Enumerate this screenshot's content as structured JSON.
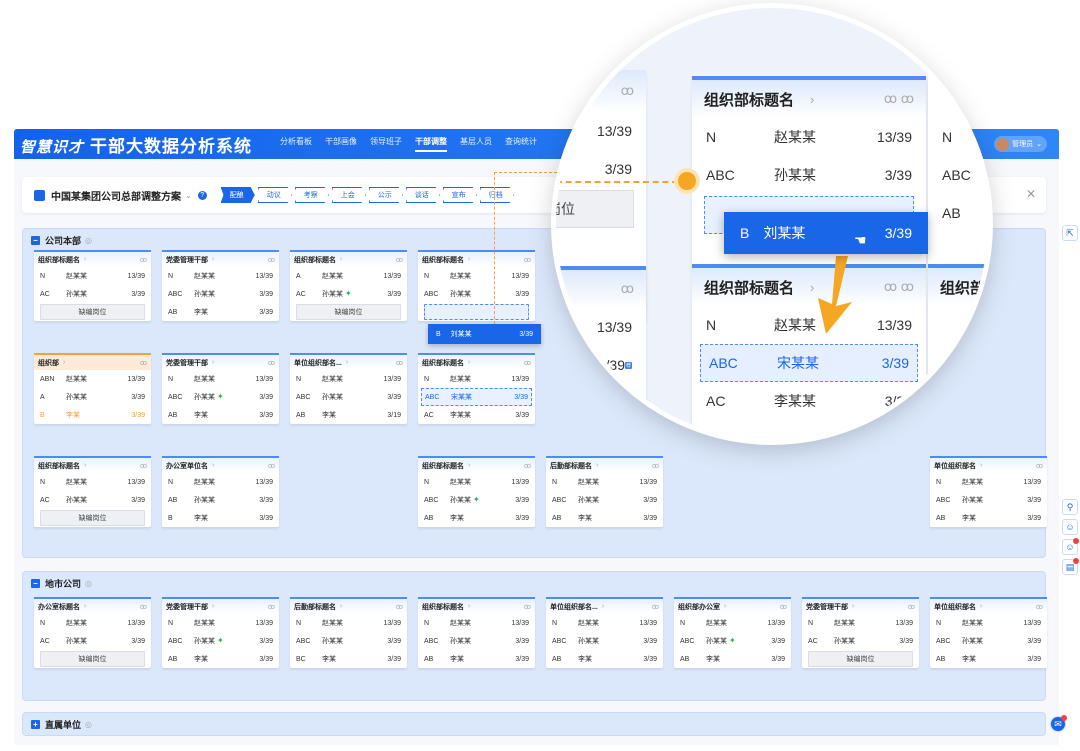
{
  "app": {
    "logo": "智慧识才",
    "title": "干部大数据分析系统"
  },
  "nav": [
    "分析看板",
    "干部画像",
    "领导班子",
    "干部调整",
    "基层人员",
    "查询统计"
  ],
  "nav_active": 3,
  "user": {
    "name": "管理员"
  },
  "plan": {
    "title": "中国某集团公司总部调整方案",
    "steps": [
      "配酿",
      "动议",
      "考察",
      "上会",
      "公示",
      "谈话",
      "宣布",
      "归档"
    ],
    "active_step": 0
  },
  "sections": [
    {
      "title": "公司本部"
    },
    {
      "title": "地市公司"
    },
    {
      "title": "直属单位"
    }
  ],
  "drag": {
    "code": "B",
    "name": "刘某某",
    "value": "3/39"
  },
  "vacancy": "缺编岗位",
  "cards_head": [
    {
      "title": "组织部标题名",
      "rows": [
        [
          "N",
          "赵某某",
          "13/39"
        ],
        [
          "AC",
          "孙某某",
          "3/39"
        ]
      ],
      "vac": true
    },
    {
      "title": "党委管理干部",
      "rows": [
        [
          "N",
          "赵某某",
          "13/39"
        ],
        [
          "ABC",
          "孙某某",
          "3/39"
        ],
        [
          "AB",
          "李某",
          "3/39"
        ]
      ]
    },
    {
      "title": "组织部标题名",
      "rows": [
        [
          "A",
          "赵某某",
          "13/39"
        ],
        [
          "AC",
          "孙某某",
          "3/39"
        ]
      ],
      "vac": true,
      "pin": 1
    },
    {
      "title": "组织部标题名",
      "rows": [
        [
          "N",
          "赵某某",
          "13/39"
        ],
        [
          "ABC",
          "孙某某",
          "3/39"
        ]
      ],
      "drop": true
    },
    {
      "title": "组织部",
      "orange": true,
      "rows": [
        [
          "ABN",
          "赵某某",
          "13/39"
        ],
        [
          "A",
          "孙某某",
          "3/39"
        ],
        [
          "B",
          "李某",
          "3/39"
        ]
      ],
      "warn": 2
    },
    {
      "title": "党委管理干部",
      "rows": [
        [
          "N",
          "赵某某",
          "13/39"
        ],
        [
          "ABC",
          "孙某某",
          "3/39"
        ],
        [
          "AB",
          "李某",
          "3/39"
        ]
      ],
      "pin": 1
    },
    {
      "title": "单位组织部名...",
      "rows": [
        [
          "N",
          "赵某某",
          "13/39"
        ],
        [
          "ABC",
          "孙某某",
          "3/39"
        ],
        [
          "AB",
          "李某",
          "3/19"
        ]
      ]
    },
    {
      "title": "组织部标题名",
      "rows": [
        [
          "N",
          "赵某某",
          "13/39"
        ],
        [
          "ABC",
          "宋某某",
          "3/39"
        ],
        [
          "AC",
          "李某某",
          "3/39"
        ]
      ],
      "hl": 1
    },
    {
      "title": "组织部标题名",
      "rows": [
        [
          "N",
          "赵某某",
          "13/39"
        ],
        [
          "AC",
          "孙某某",
          "3/39"
        ]
      ],
      "vac": true
    },
    {
      "title": "办公室单位名",
      "rows": [
        [
          "N",
          "赵某某",
          "13/39"
        ],
        [
          "AB",
          "孙某某",
          "3/39"
        ],
        [
          "B",
          "李某",
          "3/39"
        ]
      ]
    },
    {
      "title": "组织部标题名",
      "rows": [
        [
          "N",
          "赵某某",
          "13/39"
        ],
        [
          "ABC",
          "孙某某",
          "3/39"
        ],
        [
          "AB",
          "李某",
          "3/39"
        ]
      ],
      "pin": 1
    },
    {
      "title": "后勤部标题名",
      "rows": [
        [
          "N",
          "赵某某",
          "13/39"
        ],
        [
          "ABC",
          "孙某某",
          "3/39"
        ],
        [
          "AB",
          "李某",
          "3/39"
        ]
      ]
    },
    {
      "title": "单位组织部名",
      "rows": [
        [
          "N",
          "赵某某",
          "13/39"
        ],
        [
          "ABC",
          "孙某某",
          "3/39"
        ],
        [
          "AB",
          "李某",
          "3/39"
        ]
      ]
    }
  ],
  "cards_city": [
    {
      "title": "办公室标题名",
      "rows": [
        [
          "N",
          "赵某某",
          "13/39"
        ],
        [
          "AC",
          "孙某某",
          "3/39"
        ]
      ],
      "vac": true
    },
    {
      "title": "党委管理干部",
      "rows": [
        [
          "N",
          "赵某某",
          "13/39"
        ],
        [
          "ABC",
          "孙某某",
          "3/39"
        ],
        [
          "AB",
          "李某",
          "3/39"
        ]
      ],
      "pin": 1
    },
    {
      "title": "后勤部标题名",
      "rows": [
        [
          "N",
          "赵某某",
          "13/39"
        ],
        [
          "ABC",
          "孙某某",
          "3/39"
        ],
        [
          "BC",
          "李某",
          "3/39"
        ]
      ]
    },
    {
      "title": "组织部标题名",
      "rows": [
        [
          "N",
          "赵某某",
          "13/39"
        ],
        [
          "ABC",
          "孙某某",
          "3/39"
        ],
        [
          "AB",
          "李某",
          "3/39"
        ]
      ]
    },
    {
      "title": "单位组织部名...",
      "rows": [
        [
          "N",
          "赵某某",
          "13/39"
        ],
        [
          "ABC",
          "孙某某",
          "3/39"
        ],
        [
          "AB",
          "李某",
          "3/39"
        ]
      ]
    },
    {
      "title": "组织部办公室",
      "rows": [
        [
          "N",
          "赵某某",
          "13/39"
        ],
        [
          "ABC",
          "孙某某",
          "3/39"
        ],
        [
          "AB",
          "李某",
          "3/39"
        ]
      ],
      "pin": 1
    },
    {
      "title": "党委管理干部",
      "rows": [
        [
          "N",
          "赵某某",
          "13/39"
        ],
        [
          "AC",
          "孙某某",
          "3/39"
        ]
      ],
      "vac": true
    },
    {
      "title": "单位组织部名",
      "rows": [
        [
          "N",
          "赵某某",
          "13/39"
        ],
        [
          "ABC",
          "孙某某",
          "3/39"
        ],
        [
          "AB",
          "李某",
          "3/39"
        ]
      ]
    }
  ],
  "zoom": {
    "cards": [
      {
        "title": "组织部标题名",
        "rows": [
          [
            "N",
            "赵某某",
            "13/39"
          ],
          [
            "ABC",
            "孙某某",
            "3/39"
          ]
        ],
        "vac": true
      },
      {
        "title": "组织部标题名",
        "rows": [
          [
            "N",
            "赵某某",
            "13/39"
          ],
          [
            "ABC",
            "宋某某",
            "3/39"
          ],
          [
            "AC",
            "李某某",
            "3/39"
          ]
        ],
        "hl": 1
      }
    ],
    "left_values": [
      "13/39",
      "3/39",
      "3/39",
      "3/19"
    ],
    "left_label": "岗位",
    "right_rows": [
      "N",
      "ABC",
      "AB"
    ],
    "right_title": "组织部",
    "tag": "荐"
  }
}
